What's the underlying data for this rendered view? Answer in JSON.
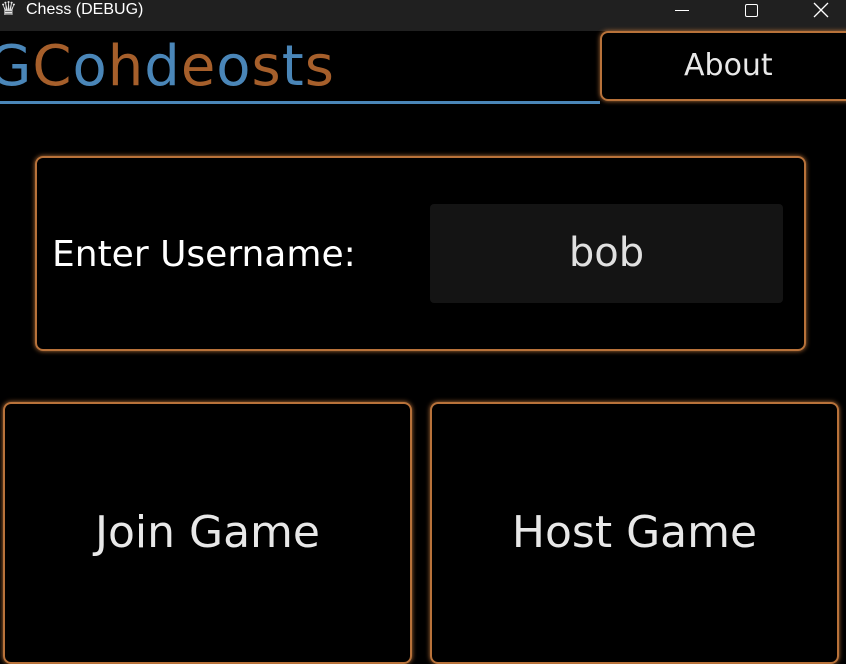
{
  "window": {
    "title": "Chess (DEBUG)",
    "app_icon": "chess-queen-icon",
    "controls": [
      "minimize-icon",
      "maximize-icon",
      "close-icon"
    ]
  },
  "header": {
    "logo_letters": [
      {
        "char": "G",
        "color": "#4a86b8"
      },
      {
        "char": "C",
        "color": "#a65f2b"
      },
      {
        "char": "o",
        "color": "#4a86b8"
      },
      {
        "char": "h",
        "color": "#a65f2b"
      },
      {
        "char": "d",
        "color": "#4a86b8"
      },
      {
        "char": "e",
        "color": "#a65f2b"
      },
      {
        "char": "o",
        "color": "#4a86b8"
      },
      {
        "char": "s",
        "color": "#a65f2b"
      },
      {
        "char": "t",
        "color": "#4a86b8"
      },
      {
        "char": "s",
        "color": "#a65f2b"
      }
    ],
    "about_label": "About"
  },
  "username": {
    "label": "Enter Username:",
    "value": "bob"
  },
  "actions": {
    "join_label": "Join Game",
    "host_label": "Host Game"
  },
  "colors": {
    "accent_orange": "#b8723a",
    "accent_blue": "#4a86b8",
    "background": "#000000",
    "input_background": "#141414"
  }
}
